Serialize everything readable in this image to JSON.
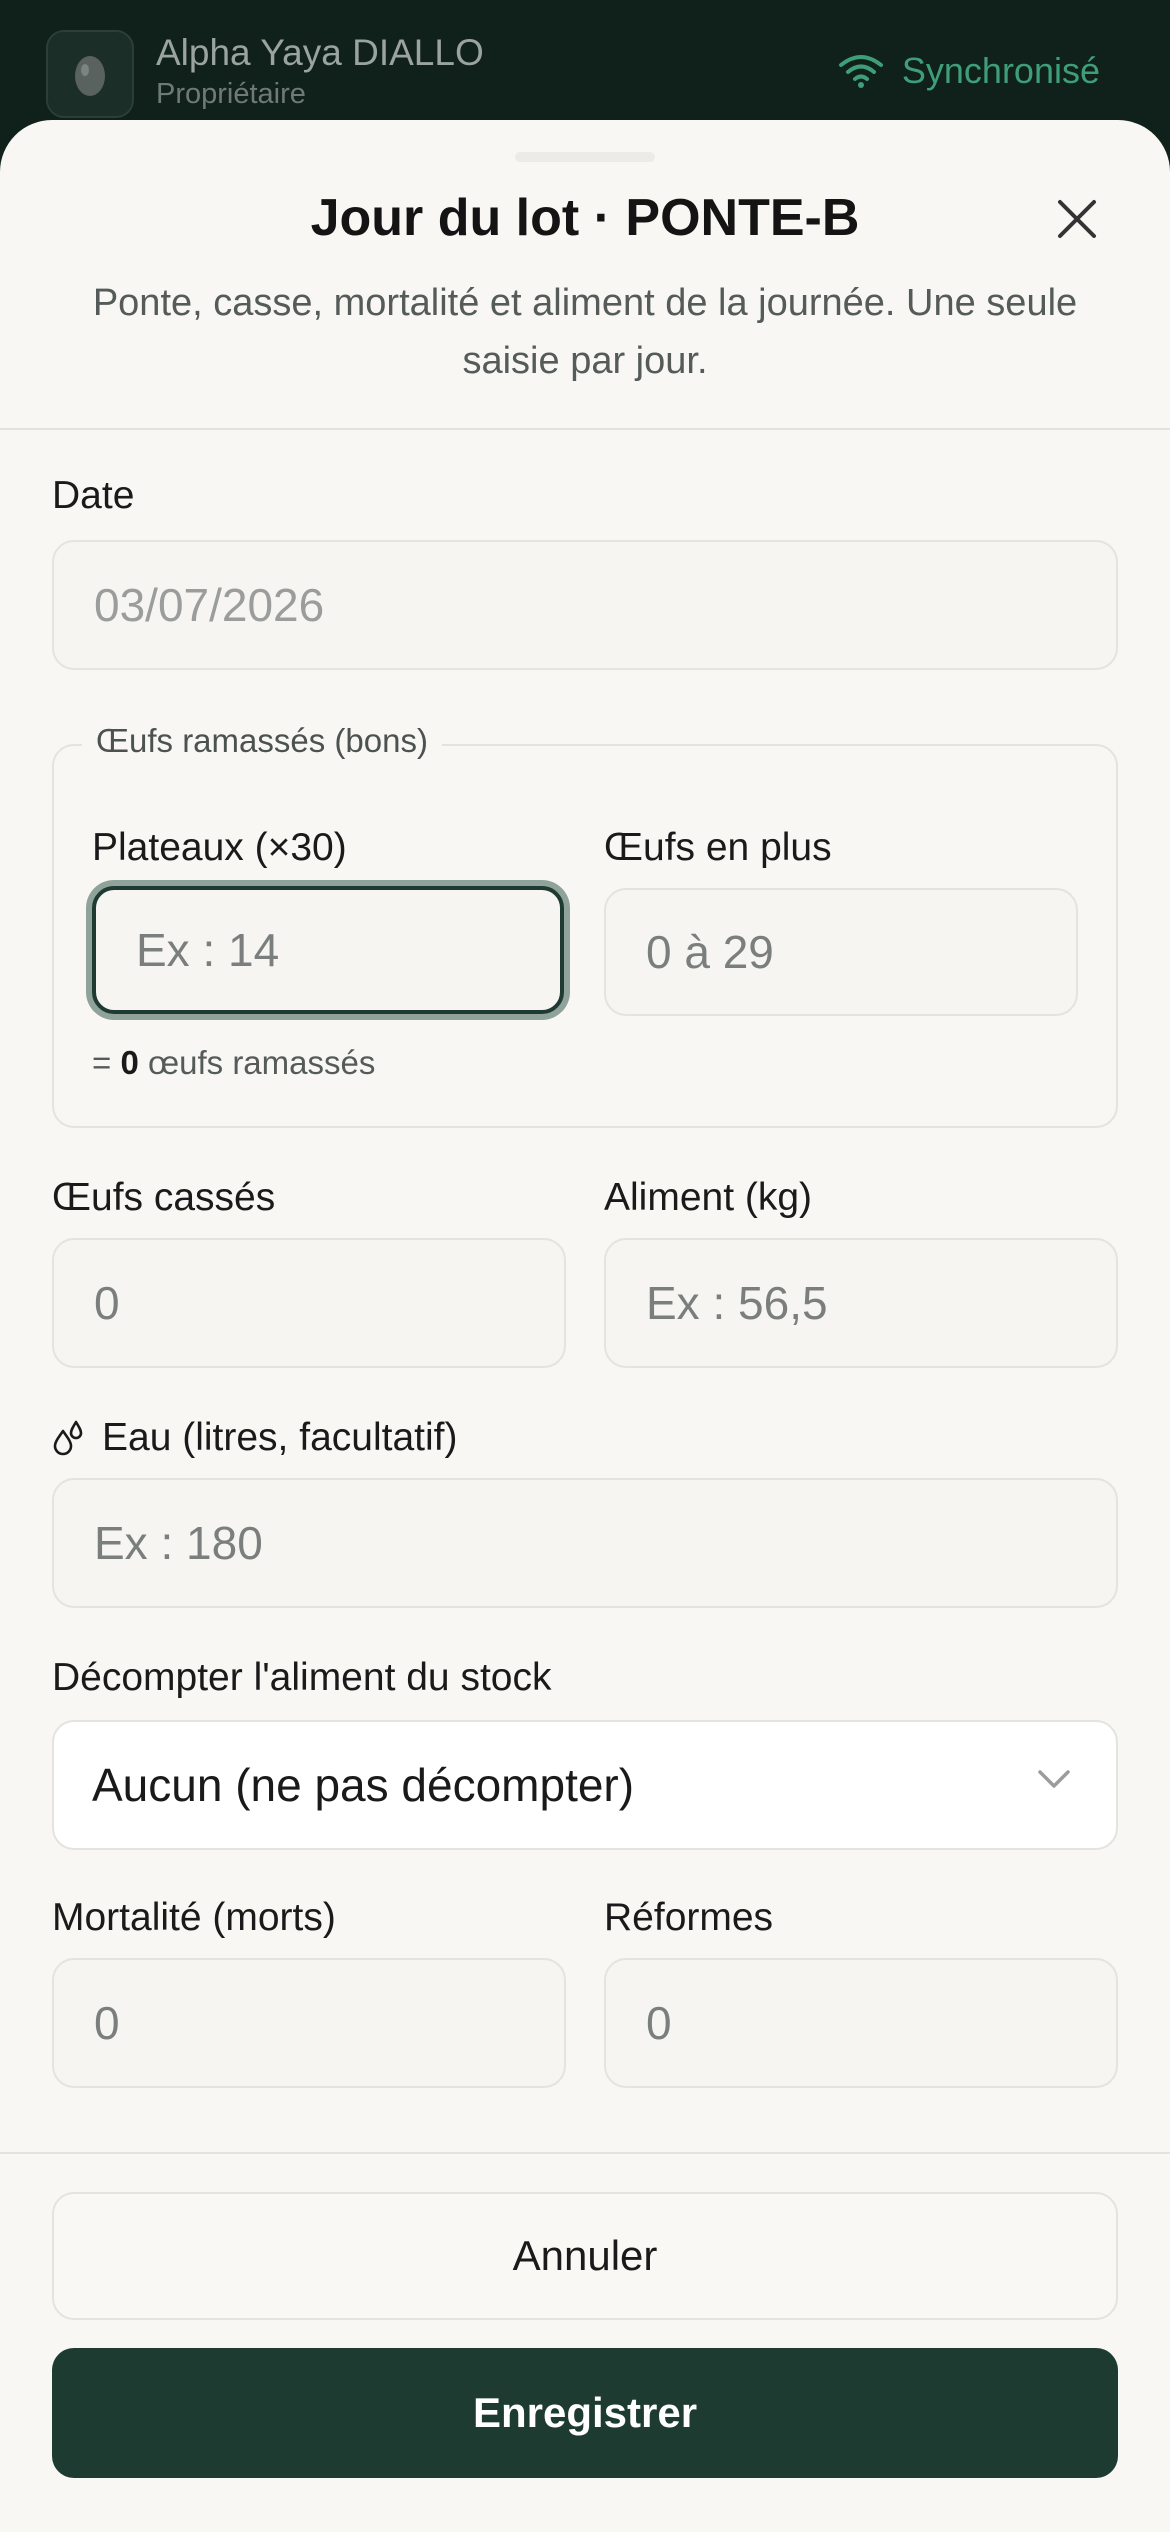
{
  "header": {
    "user_name": "Alpha Yaya DIALLO",
    "user_role": "Propriétaire",
    "sync_status": "Synchronisé",
    "sync_color": "#3f9e7a"
  },
  "sheet": {
    "title": "Jour du lot · PONTE-B",
    "subtitle": "Ponte, casse, mortalité et aliment de la journée. Une seule saisie par jour."
  },
  "form": {
    "date": {
      "label": "Date",
      "value": "03/07/2026"
    },
    "eggs_group": {
      "legend": "Œufs ramassés (bons)",
      "trays": {
        "label": "Plateaux (×30)",
        "placeholder": "Ex : 14"
      },
      "extra": {
        "label": "Œufs en plus",
        "placeholder": "0 à 29"
      },
      "hint_prefix": "=",
      "hint_count": "0",
      "hint_suffix": "œufs ramassés"
    },
    "broken": {
      "label": "Œufs cassés",
      "placeholder": "0"
    },
    "feed": {
      "label": "Aliment (kg)",
      "placeholder": "Ex : 56,5"
    },
    "water": {
      "label": "Eau (litres, facultatif)",
      "placeholder": "Ex : 180",
      "icon": "droplets-icon"
    },
    "stock": {
      "label": "Décompter l'aliment du stock",
      "selected": "Aucun (ne pas décompter)"
    },
    "mortality": {
      "label": "Mortalité (morts)",
      "placeholder": "0"
    },
    "culls": {
      "label": "Réformes",
      "placeholder": "0"
    }
  },
  "actions": {
    "cancel": "Annuler",
    "save": "Enregistrer",
    "save_color": "#1e3b32"
  }
}
